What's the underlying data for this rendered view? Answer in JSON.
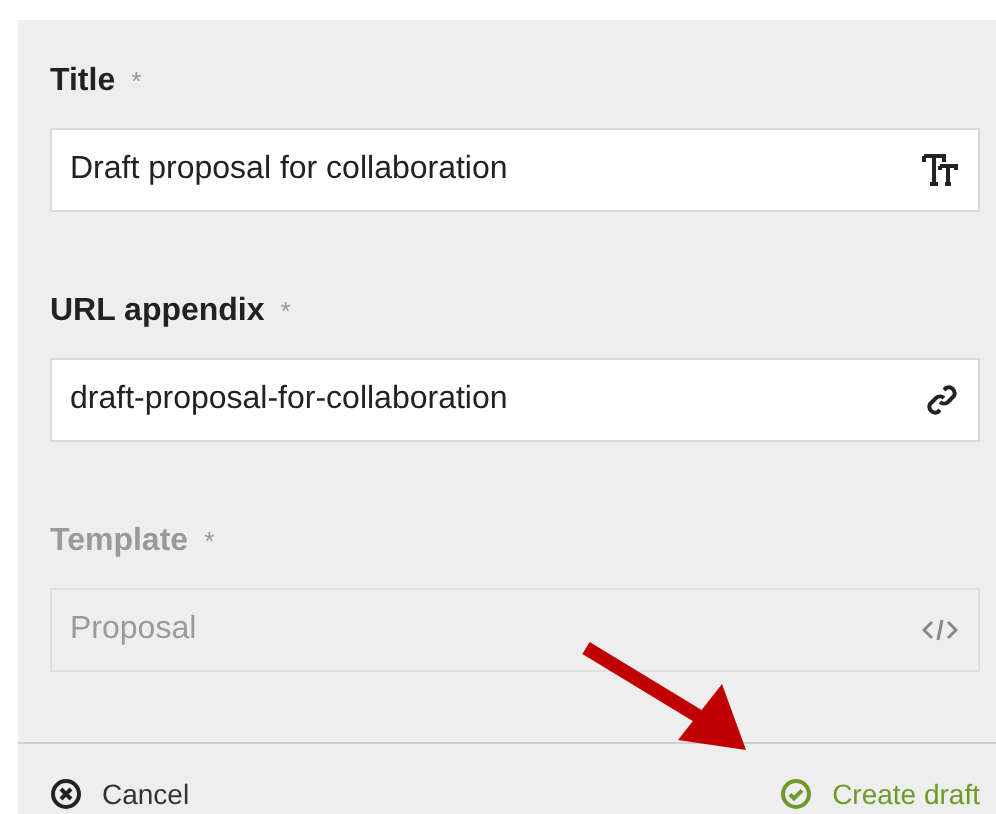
{
  "fields": [
    {
      "label": "Title",
      "required_mark": "*",
      "value": "Draft proposal for collaboration",
      "kind": "text",
      "disabled": false
    },
    {
      "label": "URL appendix",
      "required_mark": "*",
      "value": "draft-proposal-for-collaboration",
      "kind": "link",
      "disabled": false
    },
    {
      "label": "Template",
      "required_mark": "*",
      "value": "Proposal",
      "kind": "code",
      "disabled": true
    }
  ],
  "footer": {
    "cancel": "Cancel",
    "create": "Create draft"
  }
}
